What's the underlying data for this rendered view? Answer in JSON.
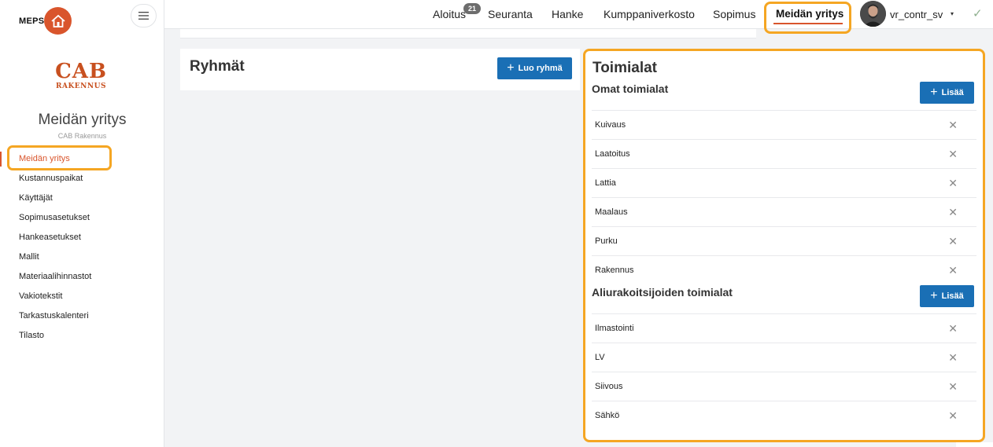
{
  "brand": {
    "name": "MEPS"
  },
  "company_logo": {
    "line1": "CAB",
    "line2": "RAKENNUS"
  },
  "sidebar": {
    "title": "Meidän yritys",
    "subtitle": "CAB Rakennus",
    "items": [
      {
        "label": "Meidän yritys"
      },
      {
        "label": "Kustannuspaikat"
      },
      {
        "label": "Käyttäjät"
      },
      {
        "label": "Sopimusasetukset"
      },
      {
        "label": "Hankeasetukset"
      },
      {
        "label": "Mallit"
      },
      {
        "label": "Materiaalihinnastot"
      },
      {
        "label": "Vakiotekstit"
      },
      {
        "label": "Tarkastuskalenteri"
      },
      {
        "label": "Tilasto"
      }
    ]
  },
  "topnav": {
    "items": [
      {
        "label": "Aloitus"
      },
      {
        "label": "Seuranta"
      },
      {
        "label": "Hanke"
      },
      {
        "label": "Kumppaniverkosto"
      },
      {
        "label": "Sopimus"
      },
      {
        "label": "Meidän yritys"
      }
    ],
    "badge": "21",
    "username": "vr_contr_sv",
    "caret": "▾",
    "check": "✓"
  },
  "ryhmat": {
    "title": "Ryhmät",
    "button_label": "Luo ryhmä"
  },
  "toimialat": {
    "title": "Toimialat",
    "own": {
      "title": "Omat toimialat",
      "button_label": "Lisää",
      "items": [
        "Kuivaus",
        "Laatoitus",
        "Lattia",
        "Maalaus",
        "Purku",
        "Rakennus"
      ]
    },
    "sub": {
      "title": "Aliurakoitsijoiden toimialat",
      "button_label": "Lisää",
      "items": [
        "Ilmastointi",
        "LV",
        "Siivous",
        "Sähkö"
      ]
    },
    "remove_symbol": "✕"
  },
  "colors": {
    "accent": "#d9552c",
    "primary_button": "#1a6fb5",
    "highlight": "#f5a623"
  },
  "icons": {
    "menu": "hamburger-icon",
    "brand": "house-icon",
    "remove": "close-icon",
    "add": "plus-icon",
    "confirm": "check-icon"
  }
}
